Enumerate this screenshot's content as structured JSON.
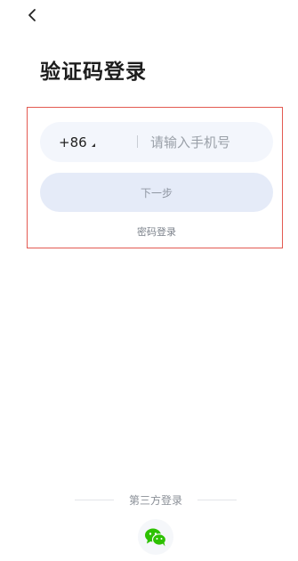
{
  "page": {
    "title": "验证码登录"
  },
  "phone_field": {
    "country_code": "+86",
    "placeholder": "请输入手机号",
    "value": ""
  },
  "next_button": {
    "label": "下一步"
  },
  "password_login": {
    "label": "密码登录"
  },
  "third_party": {
    "label": "第三方登录",
    "providers": [
      "wechat-icon"
    ]
  },
  "icons": {
    "back": "chevron-left-icon",
    "caret": "caret-down-icon"
  },
  "colors": {
    "highlight_border": "#e35a52",
    "field_background": "#f3f6fc",
    "button_background": "#e5ebf8",
    "wechat_green": "#2dc100"
  }
}
